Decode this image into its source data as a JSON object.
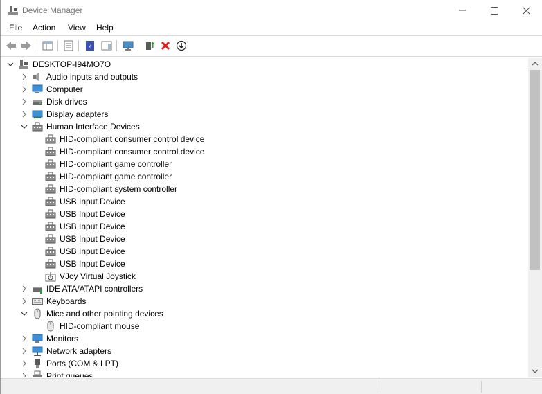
{
  "window": {
    "title": "Device Manager"
  },
  "menu": [
    {
      "label": "File"
    },
    {
      "label": "Action"
    },
    {
      "label": "View"
    },
    {
      "label": "Help"
    }
  ],
  "toolbar": [
    {
      "icon": "back-arrow-icon"
    },
    {
      "icon": "forward-arrow-icon"
    },
    {
      "icon": "show-hide-console-tree-icon"
    },
    {
      "icon": "properties-icon"
    },
    {
      "icon": "help-icon"
    },
    {
      "icon": "action-pane-icon"
    },
    {
      "icon": "scan-hardware-icon"
    },
    {
      "icon": "update-driver-icon"
    },
    {
      "icon": "uninstall-icon"
    },
    {
      "icon": "download-icon"
    }
  ],
  "tree": {
    "root": "DESKTOP-I94MO7O",
    "items": [
      {
        "label": "Audio inputs and outputs",
        "icon": "speaker-icon",
        "expanded": false
      },
      {
        "label": "Computer",
        "icon": "computer-icon",
        "expanded": false
      },
      {
        "label": "Disk drives",
        "icon": "disk-icon",
        "expanded": false
      },
      {
        "label": "Display adapters",
        "icon": "display-adapter-icon",
        "expanded": false
      },
      {
        "label": "Human Interface Devices",
        "icon": "hid-icon",
        "expanded": true
      },
      {
        "label": "HID-compliant consumer control device",
        "icon": "hid-icon"
      },
      {
        "label": "HID-compliant consumer control device",
        "icon": "hid-icon"
      },
      {
        "label": "HID-compliant game controller",
        "icon": "hid-icon"
      },
      {
        "label": "HID-compliant game controller",
        "icon": "hid-icon"
      },
      {
        "label": "HID-compliant system controller",
        "icon": "hid-icon"
      },
      {
        "label": "USB Input Device",
        "icon": "hid-icon"
      },
      {
        "label": "USB Input Device",
        "icon": "hid-icon"
      },
      {
        "label": "USB Input Device",
        "icon": "hid-icon"
      },
      {
        "label": "USB Input Device",
        "icon": "hid-icon"
      },
      {
        "label": "USB Input Device",
        "icon": "hid-icon"
      },
      {
        "label": "USB Input Device",
        "icon": "hid-icon"
      },
      {
        "label": "VJoy Virtual Joystick",
        "icon": "joystick-icon"
      },
      {
        "label": "IDE ATA/ATAPI controllers",
        "icon": "ide-controller-icon",
        "expanded": false
      },
      {
        "label": "Keyboards",
        "icon": "keyboard-icon",
        "expanded": false
      },
      {
        "label": "Mice and other pointing devices",
        "icon": "mouse-icon",
        "expanded": true
      },
      {
        "label": "HID-compliant mouse",
        "icon": "mouse-icon"
      },
      {
        "label": "Monitors",
        "icon": "monitor-icon",
        "expanded": false
      },
      {
        "label": "Network adapters",
        "icon": "network-adapter-icon",
        "expanded": false
      },
      {
        "label": "Ports (COM & LPT)",
        "icon": "port-icon",
        "expanded": false
      },
      {
        "label": "Print queues",
        "icon": "printer-icon",
        "expanded": false
      }
    ]
  },
  "colors": {
    "accent": "#0078d7",
    "text": "#000000",
    "title_text": "#7a7a7a"
  }
}
